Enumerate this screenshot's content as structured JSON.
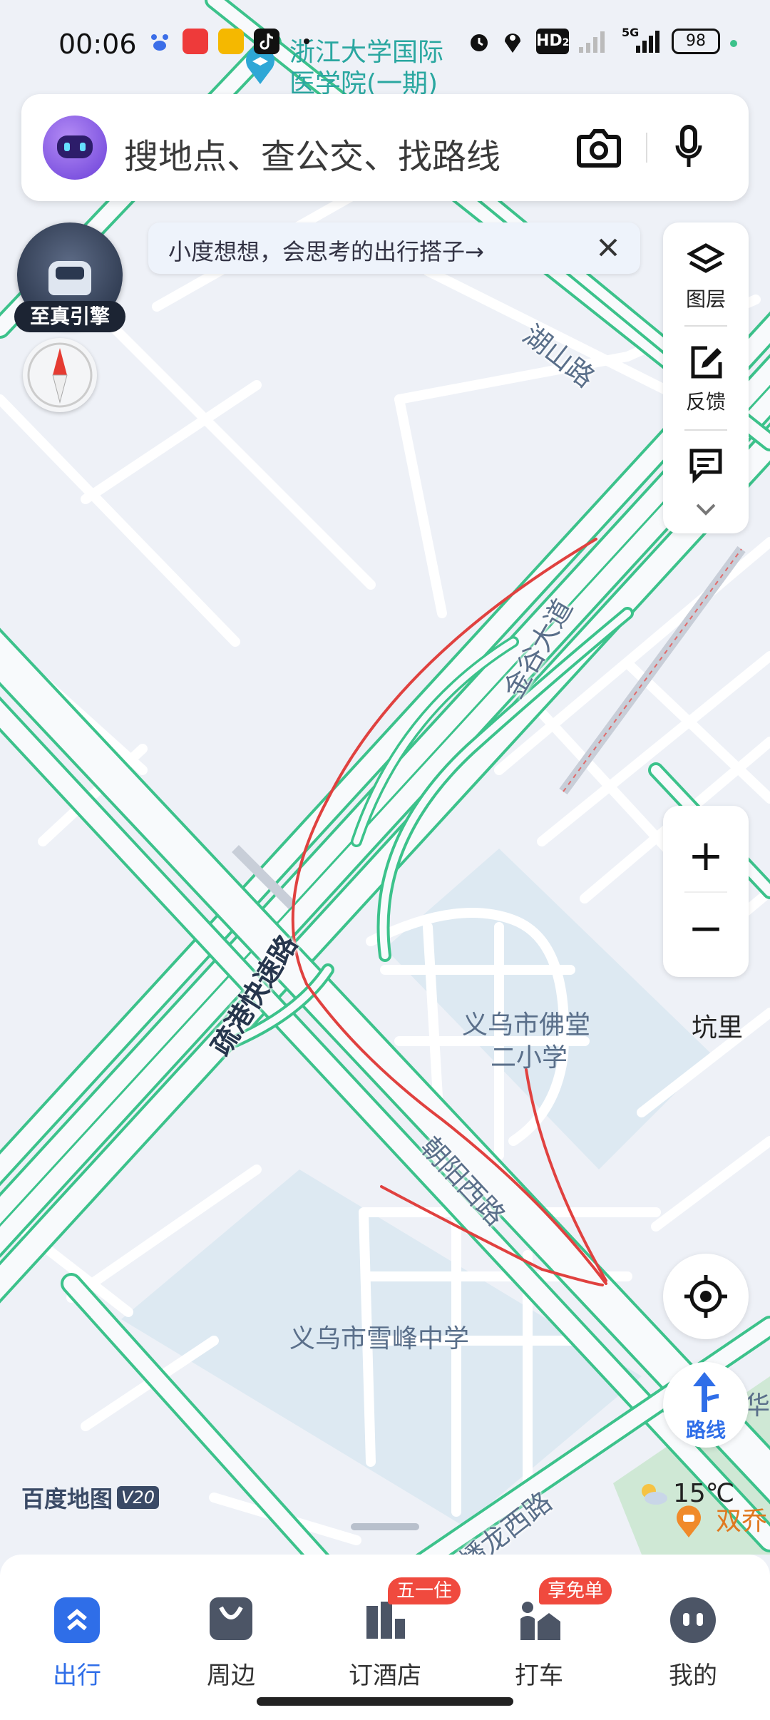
{
  "status_bar": {
    "time": "00:06",
    "battery": "98",
    "network": "5G",
    "hd_label": "HD",
    "hd_sub": "2"
  },
  "map_header_poi": {
    "line1": "浙江大学国际",
    "line2": "医学院(一期)"
  },
  "search": {
    "placeholder": "搜地点、查公交、找路线"
  },
  "tip": {
    "text": "小度想想，会思考的出行搭子→"
  },
  "promo": {
    "label": "至真引擎"
  },
  "side_panel": {
    "layers": "图层",
    "feedback": "反馈"
  },
  "zoom": {
    "in": "+",
    "out": "−"
  },
  "route_button": {
    "label": "路线"
  },
  "map_labels": {
    "hushan_road": "湖山路",
    "jingu_avenue": "金谷大道",
    "shugang_expressway": "疏港快速路",
    "chaoyang_west_road": "朝阳西路",
    "panlong_west_road": "蟠龙西路",
    "school_fotang": "义乌市佛堂\n二小学",
    "school_fotang_l1": "义乌市佛堂",
    "school_fotang_l2": "二小学",
    "school_xuefeng": "义乌市雪峰中学",
    "kengli": "坑里",
    "shuangqiao": "双乔",
    "hua": "华"
  },
  "brand": {
    "name": "百度地图",
    "version": "V20"
  },
  "weather": {
    "temp": "15℃"
  },
  "bottom_nav": [
    {
      "label": "出行",
      "badge": ""
    },
    {
      "label": "周边",
      "badge": ""
    },
    {
      "label": "订酒店",
      "badge": "五一住"
    },
    {
      "label": "打车",
      "badge": "享免单"
    },
    {
      "label": "我的",
      "badge": ""
    }
  ],
  "colors": {
    "road_green": "#3cc28b",
    "active_blue": "#2f6ee8",
    "route_red": "#e0413f",
    "badge_red": "#f04a3e"
  }
}
